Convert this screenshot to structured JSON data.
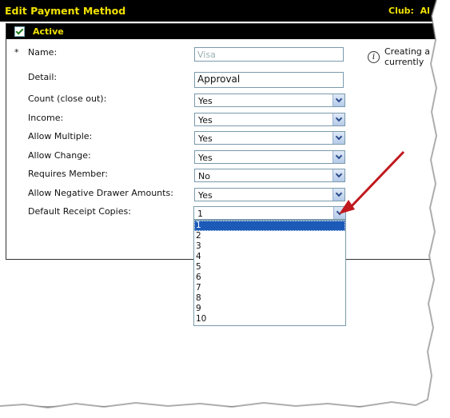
{
  "header": {
    "title": "Edit Payment Method",
    "club_label": "Club:",
    "club_value": "Al"
  },
  "active": {
    "label": "Active",
    "checked": true
  },
  "form": {
    "required_marker": "*",
    "name": {
      "label": "Name:",
      "value": "Visa"
    },
    "detail": {
      "label": "Detail:",
      "value": "Approval"
    },
    "fields": [
      {
        "label": "Count (close out):",
        "value": "Yes"
      },
      {
        "label": "Income:",
        "value": "Yes"
      },
      {
        "label": "Allow Multiple:",
        "value": "Yes"
      },
      {
        "label": "Allow Change:",
        "value": "Yes"
      },
      {
        "label": "Requires Member:",
        "value": "No"
      },
      {
        "label": "Allow Negative Drawer Amounts:",
        "value": "Yes"
      },
      {
        "label": "Default Receipt Copies:",
        "value": "1"
      }
    ]
  },
  "info": {
    "icon": "info-icon",
    "line1": "Creating a",
    "line2": "currently"
  },
  "receipt_dropdown": {
    "options": [
      "1",
      "2",
      "3",
      "4",
      "5",
      "6",
      "7",
      "8",
      "9",
      "10"
    ],
    "selected": "1"
  },
  "annotation": {
    "arrow_color": "#c0191e"
  }
}
